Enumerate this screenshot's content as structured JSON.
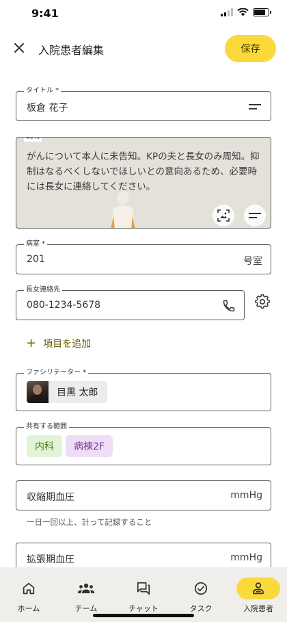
{
  "status_bar": {
    "time": "9:41"
  },
  "header": {
    "title": "入院患者編集",
    "save_label": "保存"
  },
  "fields": {
    "title": {
      "label": "タイトル *",
      "value": "板倉 花子"
    },
    "description": {
      "label": "説明",
      "value": "がんについて本人に未告知。KPの夫と長女のみ周知。抑制はなるべくしないでほしいとの意向あるため、必要時には長女に連絡してください。"
    },
    "room": {
      "label": "病室 *",
      "value": "201",
      "suffix": "号室"
    },
    "contact": {
      "label": "長女連絡先",
      "value": "080-1234-5678"
    },
    "add_item_label": "項目を追加",
    "facilitator": {
      "label": "ファシリテーター *",
      "name": "目黒 太郎"
    },
    "scope": {
      "label": "共有する範囲",
      "tags": [
        "内科",
        "病棟2F"
      ]
    },
    "systolic": {
      "placeholder": "収縮期血圧",
      "suffix": "mmHg",
      "helper": "一日一回以上、計って記録すること"
    },
    "diastolic": {
      "placeholder": "拡張期血圧",
      "suffix": "mmHg"
    }
  },
  "colors": {
    "accent": "#fbd93b",
    "tag_green_bg": "#e2f4d6",
    "tag_purple_bg": "#efdcf7"
  },
  "bottom_nav": {
    "items": [
      {
        "label": "ホーム",
        "icon": "home-icon"
      },
      {
        "label": "チーム",
        "icon": "team-icon"
      },
      {
        "label": "チャット",
        "icon": "chat-icon"
      },
      {
        "label": "タスク",
        "icon": "task-check-icon"
      },
      {
        "label": "入院患者",
        "icon": "patient-icon",
        "active": true
      }
    ]
  }
}
